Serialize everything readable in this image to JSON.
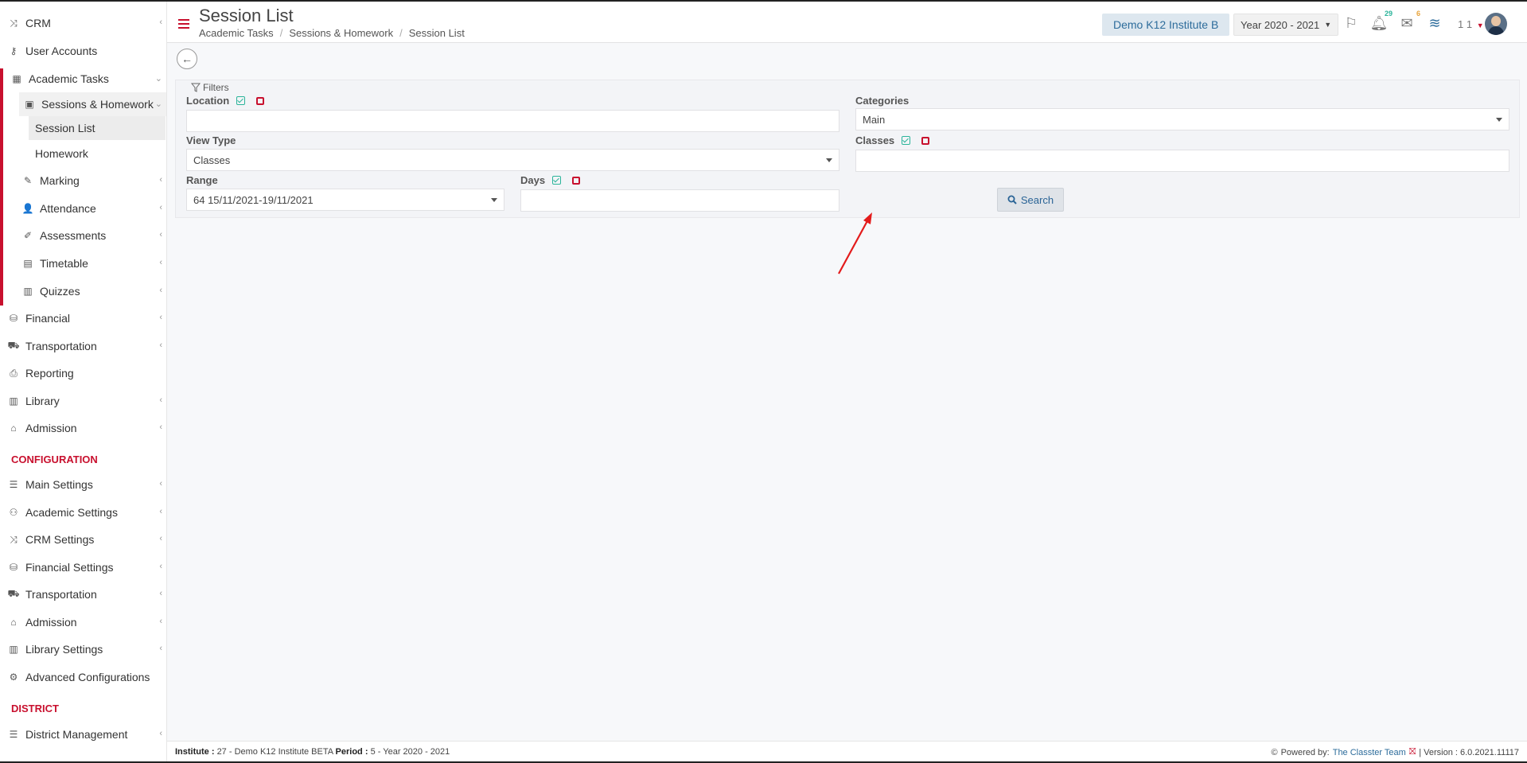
{
  "sidebar": {
    "items": [
      {
        "label": "CRM",
        "icon": "shuffle-icon"
      },
      {
        "label": "User Accounts",
        "icon": "key-icon"
      },
      {
        "label": "Academic Tasks",
        "icon": "grid-icon"
      },
      {
        "label": "Sessions & Homework",
        "icon": "teacher-icon"
      },
      {
        "label": "Session List"
      },
      {
        "label": "Homework"
      },
      {
        "label": "Marking",
        "icon": "edit-icon"
      },
      {
        "label": "Attendance",
        "icon": "user-check-icon"
      },
      {
        "label": "Assessments",
        "icon": "pencil-square-icon"
      },
      {
        "label": "Timetable",
        "icon": "calendar-icon"
      },
      {
        "label": "Quizzes",
        "icon": "book-icon"
      },
      {
        "label": "Financial",
        "icon": "coins-icon"
      },
      {
        "label": "Transportation",
        "icon": "bus-icon"
      },
      {
        "label": "Reporting",
        "icon": "printer-icon"
      },
      {
        "label": "Library",
        "icon": "books-icon"
      },
      {
        "label": "Admission",
        "icon": "bank-icon"
      }
    ],
    "config_section": "CONFIGURATION",
    "config_items": [
      {
        "label": "Main Settings",
        "icon": "sliders-icon"
      },
      {
        "label": "Academic Settings",
        "icon": "users-icon"
      },
      {
        "label": "CRM Settings",
        "icon": "shuffle-icon"
      },
      {
        "label": "Financial Settings",
        "icon": "coins-icon"
      },
      {
        "label": "Transportation",
        "icon": "bus-icon"
      },
      {
        "label": "Admission",
        "icon": "bank-icon"
      },
      {
        "label": "Library Settings",
        "icon": "books-icon"
      },
      {
        "label": "Advanced Configurations",
        "icon": "gears-icon"
      }
    ],
    "district_section": "DISTRICT",
    "district_items": [
      {
        "label": "District Management",
        "icon": "list-icon"
      }
    ]
  },
  "header": {
    "title": "Session List",
    "breadcrumb": [
      "Academic Tasks",
      "Sessions & Homework",
      "Session List"
    ],
    "institute": "Demo K12 Institute B",
    "year": "Year 2020 - 2021",
    "notifications_count": "29",
    "messages_count": "6",
    "user": "1 1"
  },
  "filters": {
    "title": "Filters",
    "location_label": "Location",
    "location_value": "",
    "categories_label": "Categories",
    "categories_value": "Main",
    "view_type_label": "View Type",
    "view_type_value": "Classes",
    "classes_label": "Classes",
    "classes_value": "",
    "range_label": "Range",
    "range_value": "64 15/11/2021-19/11/2021",
    "days_label": "Days",
    "days_value": "",
    "search_label": "Search"
  },
  "footer": {
    "institute_label": "Institute :",
    "institute_value": "27 - Demo K12 Institute BETA",
    "period_label": "Period :",
    "period_value": "5 - Year 2020 - 2021",
    "powered_by": "Powered by:",
    "team": "The Classter Team",
    "version": "| Version : 6.0.2021.11117"
  },
  "colors": {
    "accent": "#c8102e",
    "link": "#2d6c9b",
    "check": "#2bb49a",
    "annotation_arrow": "#e31b1b"
  }
}
